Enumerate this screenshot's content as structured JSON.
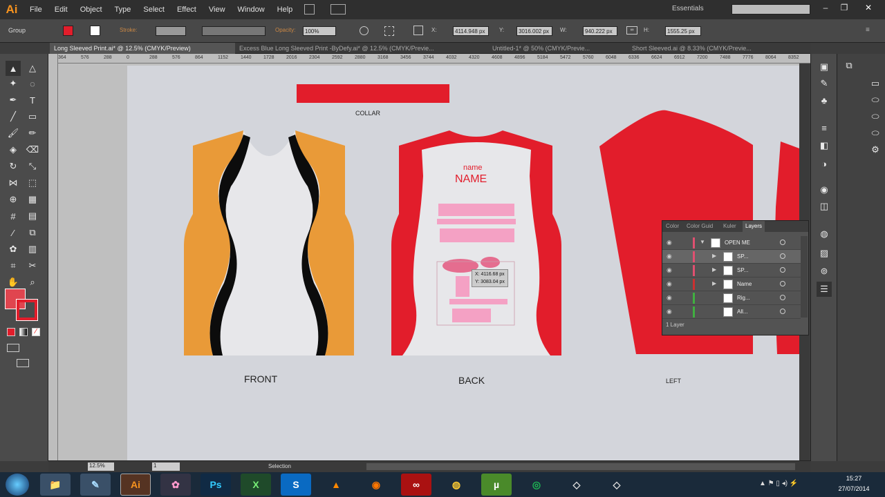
{
  "app": {
    "logo": "Ai",
    "workspace": "Essentials"
  },
  "menu": [
    "File",
    "Edit",
    "Object",
    "Type",
    "Select",
    "Effect",
    "View",
    "Window",
    "Help"
  ],
  "control": {
    "selection_type": "Group",
    "stroke_label": "Stroke:",
    "opacity_label": "Opacity:",
    "opacity_value": "100%",
    "x_label": "X:",
    "x_value": "4114.948 px",
    "y_label": "Y:",
    "y_value": "3016.002 px",
    "w_label": "W:",
    "w_value": "940.222 px",
    "h_label": "H:",
    "h_value": "1555.25 px"
  },
  "tabs": [
    "Long Sleeved Print.ai* @ 12.5% (CMYK/Preview)",
    "Excess Blue Long Sleeved Print -ByDefy.ai* @ 12.5% (CMYK/Previe...",
    "Untitled-1* @ 50% (CMYK/Previe...",
    "Short Sleeved.ai @ 8.33% (CMYK/Previe..."
  ],
  "ruler_ticks": [
    "364",
    "576",
    "288",
    "0",
    "288",
    "576",
    "864",
    "1152",
    "1440",
    "1728",
    "2016",
    "2304",
    "2592",
    "2880",
    "3168",
    "3456",
    "3744",
    "4032",
    "4320",
    "4608",
    "4896",
    "5184",
    "5472",
    "5760",
    "6048",
    "6336",
    "6624",
    "6912",
    "7200",
    "7488",
    "7776",
    "8064",
    "8352"
  ],
  "artboard": {
    "collar_label": "COLLAR",
    "front_label": "FRONT",
    "back_label": "BACK",
    "left_label": "LEFT",
    "back_text_small": "name",
    "back_text_big": "NAME",
    "tooltip_x": "X: 4116.68 px",
    "tooltip_y": "Y: 3083.04 px"
  },
  "colors": {
    "red": "#e21d2b",
    "orange": "#e99a38",
    "black": "#0c0c0c",
    "shirt_white": "#e7e7ea",
    "pink": "#f4a1c4"
  },
  "layers_panel": {
    "tabs": [
      "Color",
      "Color Guid",
      "Kuler",
      "Layers"
    ],
    "rows": [
      {
        "name": "OPEN ME",
        "color": "#e05070"
      },
      {
        "name": "SP...",
        "color": "#e05070"
      },
      {
        "name": "SP...",
        "color": "#e05070"
      },
      {
        "name": "Name",
        "color": "#cc3030"
      },
      {
        "name": "Rig...",
        "color": "#40b040"
      },
      {
        "name": "All...",
        "color": "#40b040"
      }
    ],
    "footer": "1 Layer"
  },
  "status": {
    "zoom": "12.5%",
    "page": "1",
    "tool": "Selection"
  },
  "taskbar": {
    "apps": [
      "Explorer",
      "Files",
      "Notepad",
      "Illustrator",
      "Paint",
      "Photoshop",
      "Excel",
      "Skype",
      "VLC",
      "Firefox",
      "Creative Cloud",
      "Chrome",
      "uTorrent",
      "Spotify",
      "Presenter",
      "Presenter2"
    ],
    "time": "15:27",
    "date": "27/07/2014"
  }
}
